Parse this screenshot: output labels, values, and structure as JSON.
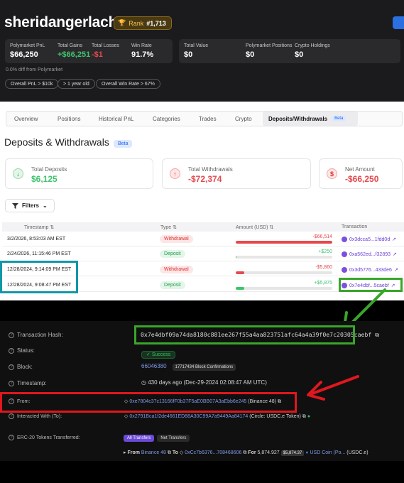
{
  "profile": {
    "username": "sheridangerlach",
    "rank_label": "Rank",
    "rank_value": "#1,713",
    "stats": [
      {
        "label": "Polymarket PnL",
        "value": "$66,250"
      },
      {
        "label": "Total Gains",
        "value": "+$66,251"
      },
      {
        "label": "Total Losses",
        "value": "-$1"
      },
      {
        "label": "Win Rate",
        "value": "91.7%"
      }
    ],
    "total_value": {
      "label": "Total Value",
      "value": "$0"
    },
    "positions": {
      "label": "Polymarket Positions",
      "value": "$0"
    },
    "crypto": {
      "label": "Crypto Holdings",
      "value": "$0"
    },
    "diff_note": "0.0% diff from Polymarket",
    "chips": [
      "Overall PnL > $10k",
      "> 1 year old",
      "Overall Win Rate > 67%"
    ]
  },
  "tabs": [
    "Overview",
    "Positions",
    "Historical PnL",
    "Categories",
    "Trades",
    "Crypto",
    "Deposits/Withdrawals"
  ],
  "tab_beta": "Beta",
  "section": {
    "title": "Deposits & Withdrawals",
    "beta": "Beta",
    "cards": [
      {
        "label": "Total Deposits",
        "value": "$6,125",
        "icon": "arrow-down-circle-icon"
      },
      {
        "label": "Total Withdrawals",
        "value": "-$72,374",
        "icon": "arrow-up-circle-icon"
      },
      {
        "label": "Net Amount",
        "value": "-$66,250",
        "icon": "dollar-icon"
      }
    ],
    "filters_label": "Filters"
  },
  "table": {
    "headers": {
      "timestamp": "Timestamp",
      "type": "Type",
      "amount": "Amount (USD)",
      "tx": "Transaction"
    },
    "rows": [
      {
        "ts": "3/2/2026, 8:53:03 AM EST",
        "type": "Withdrawal",
        "amount": "-$66,514",
        "share": 1.0,
        "tx": "0x3dcca5...1fdd0d"
      },
      {
        "ts": "2/24/2026, 11:15:46 PM EST",
        "type": "Deposit",
        "amount": "+$250",
        "share": 0.004,
        "tx": "0xa562ed...f32893"
      },
      {
        "ts": "12/28/2024, 9:14:09 PM EST",
        "type": "Withdrawal",
        "amount": "-$5,860",
        "share": 0.088,
        "tx": "0x3d5776...433de6"
      },
      {
        "ts": "12/28/2024, 9:08:47 PM EST",
        "type": "Deposit",
        "amount": "+$5,875",
        "share": 0.088,
        "tx": "0x7e4dbf...5caebf"
      }
    ]
  },
  "etherscan": {
    "tx_hash_label": "Transaction Hash:",
    "tx_hash": "0x7e4dbf09a74da8180c881ee267f55a4aa823751afc64a4a39f0e7c20305caebf",
    "status_label": "Status:",
    "status": "Success",
    "block_label": "Block:",
    "block": "66046380",
    "block_conf": "17717434 Block Confirmations",
    "timestamp_label": "Timestamp:",
    "timestamp": "430 days ago (Dec-29-2024 02:08:47 AM UTC)",
    "from_label": "From:",
    "from_addr": "0xe7804c37c13166fF0b37F5aE0BB07A3aEbb6e245",
    "from_name": "(Binance 48)",
    "to_label": "Interacted With (To):",
    "to_addr": "0x2791Bca1f2de4661ED88A30C99A7a9449Aa84174",
    "to_name": "(Circle: USDC.e Token)",
    "erc20_label": "ERC-20 Tokens Transferred:",
    "btn_all": "All Transfers",
    "btn_net": "Net Transfers",
    "tr_from": "From",
    "tr_from_name": "Binance 48",
    "tr_to": "To",
    "tr_to_addr": "0xCc7b6376...708468606",
    "tr_for": "For",
    "tr_amount": "5,874.927",
    "tr_badge": "$5,874.37",
    "tr_token": "USD Coin (Po...",
    "tr_token_sym": "(USDC.e)"
  },
  "colors": {
    "teal_box": "#1297a8",
    "green_box": "#3aa52a",
    "red_box": "#e0171e",
    "gain": "#3ec46d",
    "loss": "#e5484d"
  }
}
